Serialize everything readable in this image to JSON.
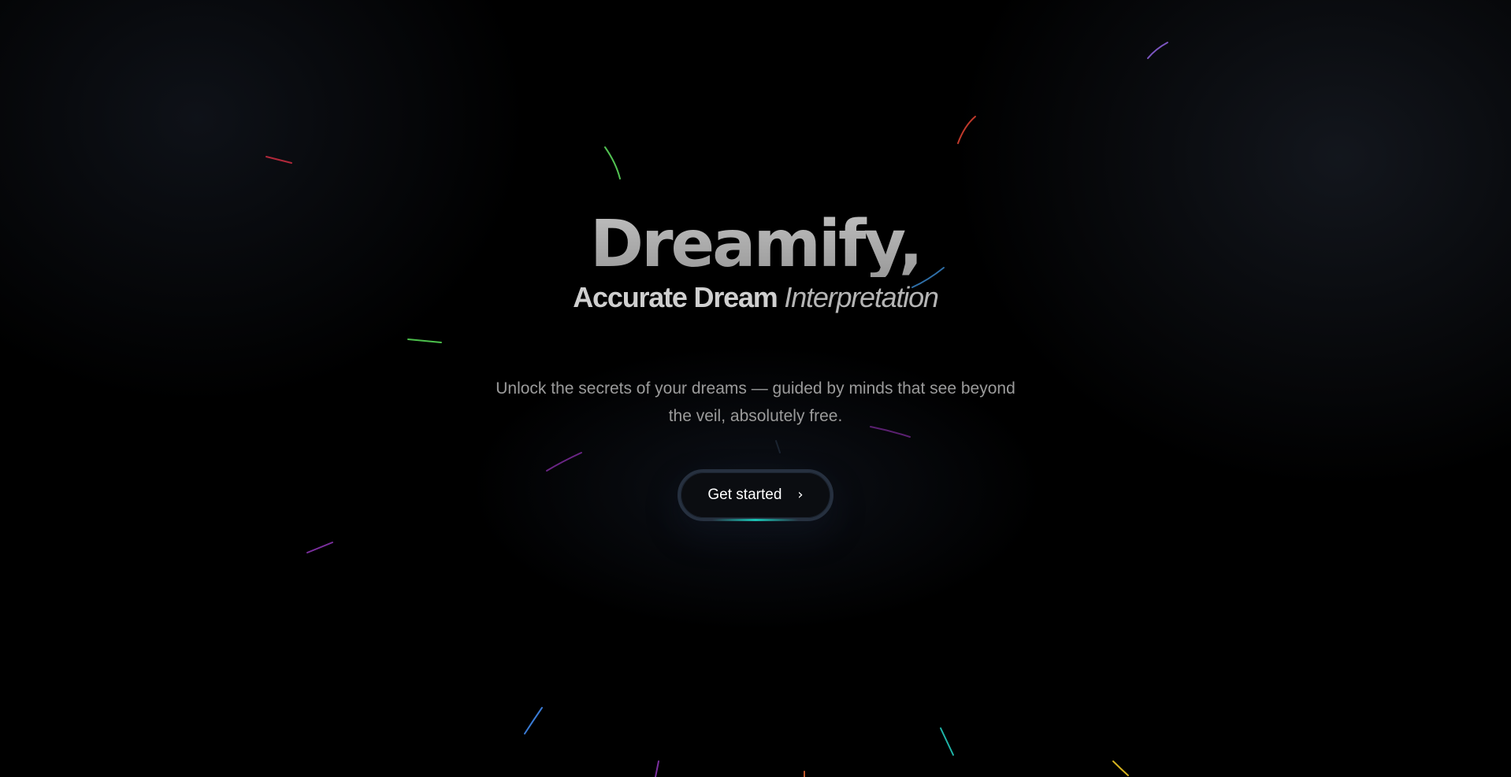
{
  "hero": {
    "title": "Dreamify,",
    "subtitle_strong": "Accurate Dream",
    "subtitle_italic": "Interpretation"
  },
  "tagline": {
    "line1": "Unlock the secrets of your dreams — guided by minds that see beyond",
    "line2": "the veil, absolutely free."
  },
  "cta": {
    "label": "Get started",
    "icon": "chevron-right-icon",
    "icon_glyph": "›"
  },
  "colors": {
    "background": "#000000",
    "title": "#a6a6a6",
    "tagline": "#9b9b9b",
    "button_bg": "#0b0d11",
    "button_border": "#26303f",
    "button_glow": "#19c2b3",
    "streak_red": "#c0392b",
    "streak_green": "#4cc04c",
    "streak_blue": "#3a7bd5",
    "streak_purple": "#7b2f9e",
    "streak_teal": "#1fb5a8",
    "streak_yellow": "#d4b21f"
  }
}
